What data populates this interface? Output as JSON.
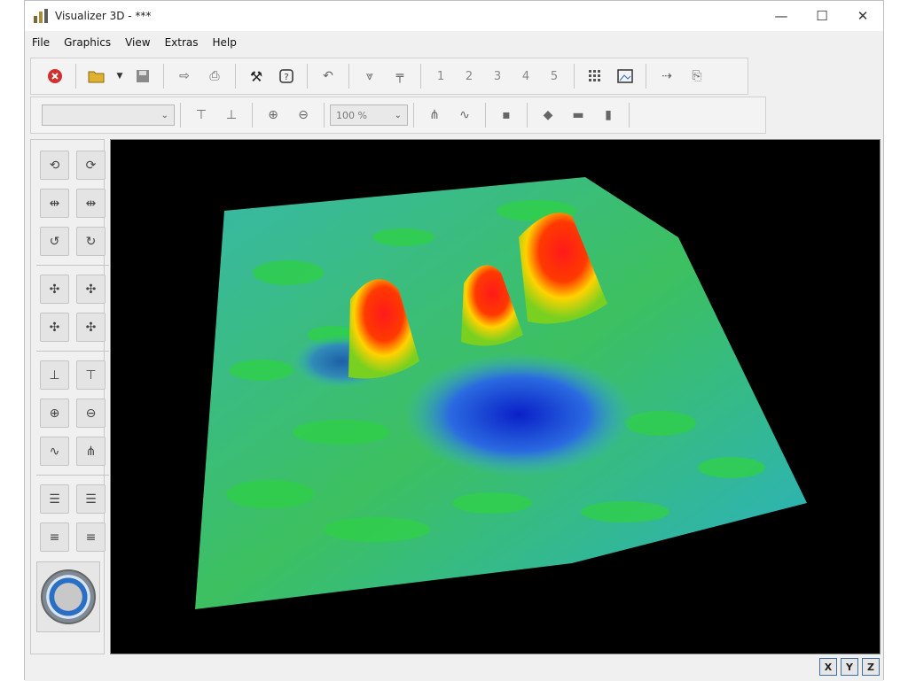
{
  "window": {
    "title": "Visualizer 3D - ***",
    "minimize": "—",
    "maximize": "☐",
    "close": "✕"
  },
  "menu": [
    "File",
    "Graphics",
    "View",
    "Extras",
    "Help"
  ],
  "toolbar1": {
    "numbers": [
      "1",
      "2",
      "3",
      "4",
      "5"
    ]
  },
  "toolbar2": {
    "combo_value": "",
    "zoom_value": "100 %"
  },
  "axes": [
    "X",
    "Y",
    "Z"
  ],
  "colors": {
    "accent": "#3a6ea5",
    "close_icon": "#d32f2f",
    "viewport_bg": "#000000"
  }
}
